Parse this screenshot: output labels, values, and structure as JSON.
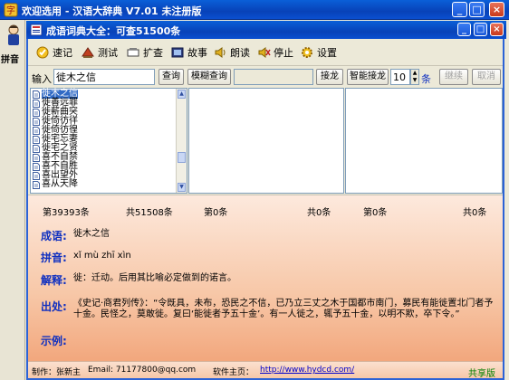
{
  "outer_window": {
    "title": "欢迎选用 - 汉语大辞典 V7.01 未注册版",
    "side_tab": "拼音"
  },
  "inner_window": {
    "title": "成语词典大全：可查51500条"
  },
  "toolbar": {
    "items": [
      {
        "label": "速记",
        "icon": "memo-icon"
      },
      {
        "label": "测试",
        "icon": "test-icon"
      },
      {
        "label": "扩查",
        "icon": "expand-search-icon"
      },
      {
        "label": "故事",
        "icon": "story-icon"
      },
      {
        "label": "朗读",
        "icon": "speaker-icon"
      },
      {
        "label": "停止",
        "icon": "stop-icon"
      },
      {
        "label": "设置",
        "icon": "settings-icon"
      }
    ]
  },
  "search": {
    "input_label": "输入",
    "input_value": "徙木之信",
    "query_button": "查询",
    "fuzzy_button": "模糊查询",
    "chain_button": "接龙",
    "smart_chain_button": "智能接龙",
    "count_value": "10",
    "count_unit": "条",
    "continue_button": "继续",
    "cancel_button": "取消"
  },
  "idiom_list": [
    {
      "text": "徙木之信",
      "selected": true
    },
    {
      "text": "徙善远罪",
      "selected": false
    },
    {
      "text": "徙薪曲突",
      "selected": false
    },
    {
      "text": "徙倚彷徉",
      "selected": false
    },
    {
      "text": "徙倚彷徨",
      "selected": false
    },
    {
      "text": "徙宅忘妻",
      "selected": false
    },
    {
      "text": "徙宅之贤",
      "selected": false
    },
    {
      "text": "喜不自禁",
      "selected": false
    },
    {
      "text": "喜不自胜",
      "selected": false
    },
    {
      "text": "喜出望外",
      "selected": false
    },
    {
      "text": "喜从天降",
      "selected": false
    }
  ],
  "stats": {
    "current": "第39393条",
    "total": "共51508条",
    "pane2_current": "第0条",
    "pane2_total": "共0条",
    "pane3_current": "第0条",
    "pane3_total": "共0条"
  },
  "entry": {
    "idiom_label": "成语:",
    "idiom_value": "徙木之信",
    "pinyin_label": "拼音:",
    "pinyin_value": "xǐ mù zhī xìn",
    "explain_label": "解释:",
    "explain_value": "徙：迁动。后用其比喻必定做到的诺言。",
    "source_label": "出处:",
    "source_value": "《史记·商君列传》：“令既具，未布，恐民之不信，已乃立三丈之木于国都市南门，募民有能徙置北门者予十金。民怪之，莫敢徙。复曰‘能徙者予五十金’。有一人徙之，辄予五十金，以明不欺，卒下令。”",
    "example_label": "示例:",
    "example_value": ""
  },
  "statusbar": {
    "author": "制作：张新主",
    "email": "Email: 71177800@qq.com",
    "homepage_label": "软件主页：",
    "homepage_url": "http://www.hydcd.com/",
    "edition": "共享版"
  },
  "colors": {
    "title_blue": "#0842b8",
    "label_blue": "#1030c0",
    "selection": "#316ac5"
  }
}
